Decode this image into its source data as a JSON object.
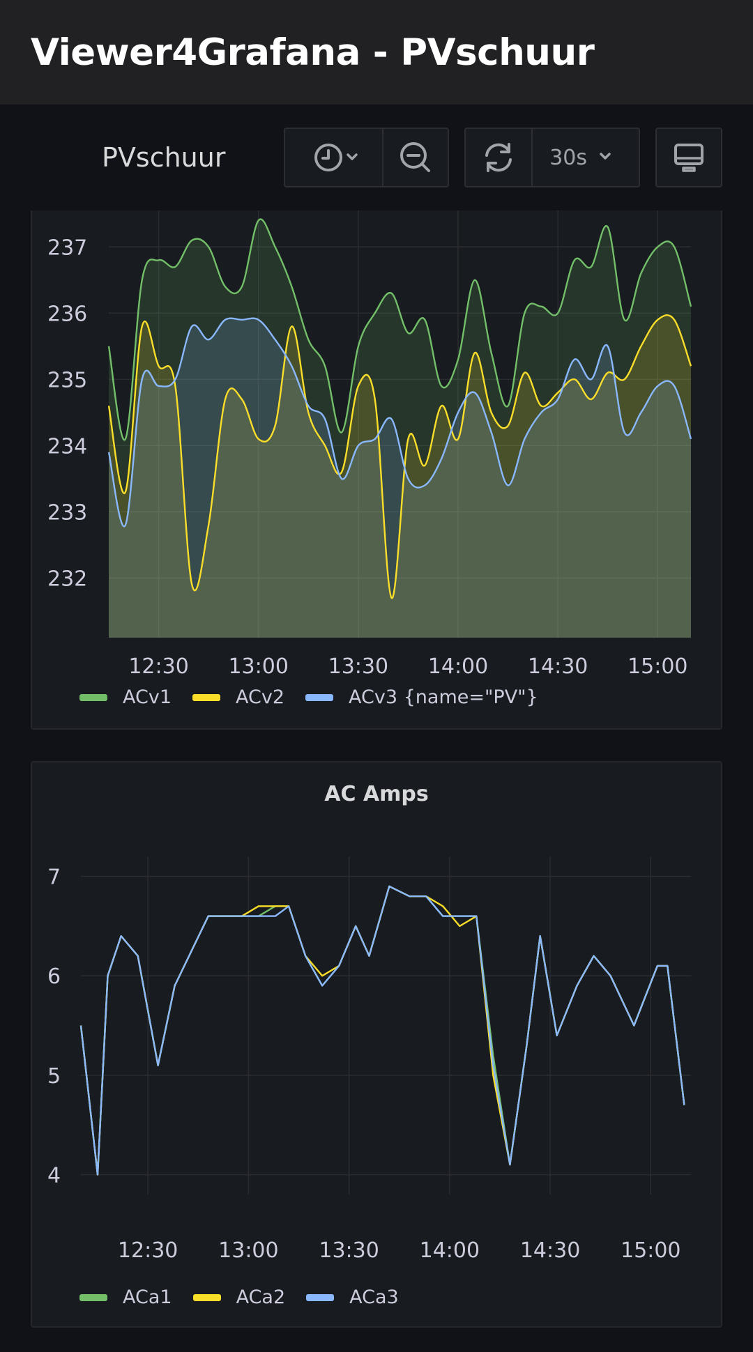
{
  "app": {
    "title": "Viewer4Grafana - PVschuur"
  },
  "toolbar": {
    "dashboard_title": "PVschuur",
    "time_picker_icon": "clock-icon",
    "refresh_interval": "30s"
  },
  "colors": {
    "acv1": "#73bf69",
    "acv2": "#fade2a",
    "acv3": "#8ab8ff"
  },
  "panels": [
    {
      "title": "",
      "legend": [
        "ACv1",
        "ACv2",
        "ACv3 {name=\"PV\"}"
      ]
    },
    {
      "title": "AC Amps",
      "legend": [
        "ACa1",
        "ACa2",
        "ACa3"
      ]
    }
  ],
  "chart_data": [
    {
      "type": "area",
      "x_ticks": [
        "12:30",
        "13:00",
        "13:30",
        "14:00",
        "14:30",
        "15:00"
      ],
      "y_ticks": [
        232,
        233,
        234,
        235,
        236,
        237
      ],
      "xlim": [
        "12:15",
        "15:10"
      ],
      "ylim": [
        231.1,
        237.55
      ],
      "legend_position": "bottom-left",
      "grid": true,
      "series": [
        {
          "name": "ACv1",
          "x": [
            "12:15",
            "12:20",
            "12:25",
            "12:30",
            "12:35",
            "12:40",
            "12:45",
            "12:50",
            "12:55",
            "13:00",
            "13:05",
            "13:10",
            "13:15",
            "13:20",
            "13:25",
            "13:30",
            "13:35",
            "13:40",
            "13:45",
            "13:50",
            "13:55",
            "14:00",
            "14:05",
            "14:10",
            "14:15",
            "14:20",
            "14:25",
            "14:30",
            "14:35",
            "14:40",
            "14:45",
            "14:50",
            "14:55",
            "15:00",
            "15:05",
            "15:10"
          ],
          "values": [
            235.5,
            234.1,
            236.5,
            236.8,
            236.7,
            237.1,
            237.0,
            236.4,
            236.4,
            237.4,
            237.0,
            236.4,
            235.6,
            235.2,
            234.2,
            235.5,
            236.0,
            236.3,
            235.7,
            235.9,
            234.9,
            235.3,
            236.5,
            235.4,
            234.6,
            236.0,
            236.1,
            236.0,
            236.8,
            236.7,
            237.3,
            235.9,
            236.6,
            237.0,
            237.0,
            236.1
          ]
        },
        {
          "name": "ACv2",
          "x": [
            "12:15",
            "12:20",
            "12:25",
            "12:30",
            "12:35",
            "12:40",
            "12:45",
            "12:50",
            "12:55",
            "13:00",
            "13:05",
            "13:10",
            "13:15",
            "13:20",
            "13:25",
            "13:30",
            "13:35",
            "13:40",
            "13:45",
            "13:50",
            "13:55",
            "14:00",
            "14:05",
            "14:10",
            "14:15",
            "14:20",
            "14:25",
            "14:30",
            "14:35",
            "14:40",
            "14:45",
            "14:50",
            "14:55",
            "15:00",
            "15:05",
            "15:10"
          ],
          "values": [
            234.6,
            233.3,
            235.8,
            235.2,
            234.9,
            231.9,
            232.8,
            234.7,
            234.7,
            234.1,
            234.3,
            235.8,
            234.5,
            234.0,
            233.6,
            234.9,
            234.7,
            231.7,
            234.1,
            233.7,
            234.6,
            234.1,
            235.4,
            234.5,
            234.3,
            235.1,
            234.6,
            234.8,
            235.0,
            234.7,
            235.1,
            235.0,
            235.5,
            235.9,
            235.9,
            235.2
          ]
        },
        {
          "name": "ACv3 {name=\"PV\"}",
          "x": [
            "12:15",
            "12:20",
            "12:25",
            "12:30",
            "12:35",
            "12:40",
            "12:45",
            "12:50",
            "12:55",
            "13:00",
            "13:05",
            "13:10",
            "13:15",
            "13:20",
            "13:25",
            "13:30",
            "13:35",
            "13:40",
            "13:45",
            "13:50",
            "13:55",
            "14:00",
            "14:05",
            "14:10",
            "14:15",
            "14:20",
            "14:25",
            "14:30",
            "14:35",
            "14:40",
            "14:45",
            "14:50",
            "14:55",
            "15:00",
            "15:05",
            "15:10"
          ],
          "values": [
            233.9,
            232.8,
            235.0,
            234.9,
            235.0,
            235.8,
            235.6,
            235.9,
            235.9,
            235.9,
            235.6,
            235.2,
            234.6,
            234.4,
            233.5,
            234.0,
            234.1,
            234.4,
            233.5,
            233.4,
            233.8,
            234.5,
            234.8,
            234.2,
            233.4,
            234.1,
            234.5,
            234.7,
            235.3,
            235.0,
            235.5,
            234.2,
            234.5,
            234.9,
            234.9,
            234.1
          ]
        }
      ]
    },
    {
      "type": "line",
      "title": "AC Amps",
      "x_ticks": [
        "12:30",
        "13:00",
        "13:30",
        "14:00",
        "14:30",
        "15:00"
      ],
      "y_ticks": [
        4,
        5,
        6,
        7
      ],
      "xlim": [
        "12:10",
        "15:12"
      ],
      "ylim": [
        3.8,
        7.2
      ],
      "legend_position": "bottom-left",
      "grid": true,
      "series": [
        {
          "name": "ACa1",
          "x": [
            "12:10",
            "12:15",
            "12:18",
            "12:22",
            "12:27",
            "12:33",
            "12:38",
            "12:48",
            "12:58",
            "13:03",
            "13:08",
            "13:12",
            "13:17",
            "13:22",
            "13:27",
            "13:32",
            "13:36",
            "13:42",
            "13:48",
            "13:53",
            "13:58",
            "14:03",
            "14:08",
            "14:13",
            "14:18",
            "14:23",
            "14:27",
            "14:32",
            "14:38",
            "14:43",
            "14:48",
            "14:55",
            "15:02",
            "15:05",
            "15:10"
          ],
          "values": [
            5.5,
            4.0,
            6.0,
            6.4,
            6.2,
            5.1,
            5.9,
            6.6,
            6.6,
            6.6,
            6.7,
            6.7,
            6.2,
            5.9,
            6.1,
            6.5,
            6.2,
            6.9,
            6.8,
            6.8,
            6.6,
            6.6,
            6.6,
            5.2,
            4.1,
            5.3,
            6.4,
            5.4,
            5.9,
            6.2,
            6.0,
            5.5,
            6.1,
            6.1,
            4.7
          ]
        },
        {
          "name": "ACa2",
          "x": [
            "12:10",
            "12:15",
            "12:18",
            "12:22",
            "12:27",
            "12:33",
            "12:38",
            "12:48",
            "12:58",
            "13:03",
            "13:08",
            "13:12",
            "13:17",
            "13:22",
            "13:27",
            "13:32",
            "13:36",
            "13:42",
            "13:48",
            "13:53",
            "13:58",
            "14:03",
            "14:08",
            "14:13",
            "14:18",
            "14:23",
            "14:27",
            "14:32",
            "14:38",
            "14:43",
            "14:48",
            "14:55",
            "15:02",
            "15:05",
            "15:10"
          ],
          "values": [
            5.5,
            4.0,
            6.0,
            6.4,
            6.2,
            5.1,
            5.9,
            6.6,
            6.6,
            6.7,
            6.7,
            6.7,
            6.2,
            6.0,
            6.1,
            6.5,
            6.2,
            6.9,
            6.8,
            6.8,
            6.7,
            6.5,
            6.6,
            5.0,
            4.1,
            5.3,
            6.4,
            5.4,
            5.9,
            6.2,
            6.0,
            5.5,
            6.1,
            6.1,
            4.7
          ]
        },
        {
          "name": "ACa3",
          "x": [
            "12:10",
            "12:15",
            "12:18",
            "12:22",
            "12:27",
            "12:33",
            "12:38",
            "12:48",
            "12:58",
            "13:03",
            "13:08",
            "13:12",
            "13:17",
            "13:22",
            "13:27",
            "13:32",
            "13:36",
            "13:42",
            "13:48",
            "13:53",
            "13:58",
            "14:03",
            "14:08",
            "14:13",
            "14:18",
            "14:23",
            "14:27",
            "14:32",
            "14:38",
            "14:43",
            "14:48",
            "14:55",
            "15:02",
            "15:05",
            "15:10"
          ],
          "values": [
            5.5,
            4.0,
            6.0,
            6.4,
            6.2,
            5.1,
            5.9,
            6.6,
            6.6,
            6.6,
            6.6,
            6.7,
            6.2,
            5.9,
            6.1,
            6.5,
            6.2,
            6.9,
            6.8,
            6.8,
            6.6,
            6.6,
            6.6,
            5.1,
            4.1,
            5.3,
            6.4,
            5.4,
            5.9,
            6.2,
            6.0,
            5.5,
            6.1,
            6.1,
            4.7
          ]
        }
      ]
    }
  ]
}
